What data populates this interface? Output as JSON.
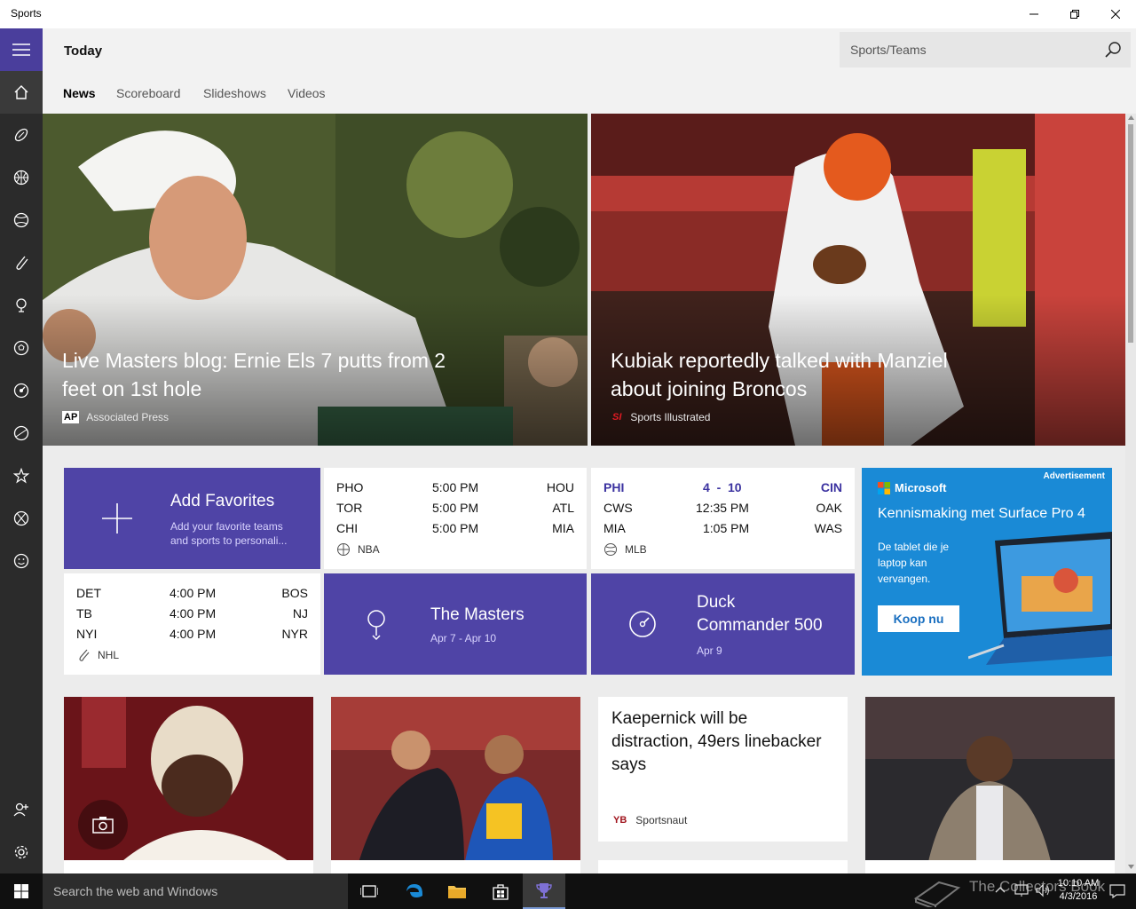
{
  "window": {
    "title": "Sports"
  },
  "header": {
    "title": "Today",
    "tabs": [
      {
        "label": "News",
        "active": true
      },
      {
        "label": "Scoreboard",
        "active": false
      },
      {
        "label": "Slideshows",
        "active": false
      },
      {
        "label": "Videos",
        "active": false
      }
    ],
    "search": {
      "placeholder": "Sports/Teams"
    }
  },
  "rail": {
    "items": [
      "menu-icon",
      "home-icon",
      "football-icon",
      "basketball-icon",
      "baseball-icon",
      "hockey-icon",
      "golf-icon",
      "soccer-icon",
      "nascar-icon",
      "tennis-icon",
      "star-icon",
      "sports-ball-icon",
      "smiley-icon",
      "add-user-icon",
      "gear-icon"
    ],
    "accent": "#4a3e9c"
  },
  "heroes": [
    {
      "headline": "Live Masters blog: Ernie Els 7 putts from 2 feet on 1st hole",
      "logo": "AP",
      "source": "Associated Press"
    },
    {
      "headline": "Kubiak reportedly talked with Manziel about joining Broncos",
      "logo": "SI",
      "source": "Sports Illustrated"
    }
  ],
  "favorites": {
    "title": "Add Favorites",
    "subtitle": "Add your favorite teams and sports to personali..."
  },
  "nba": {
    "league": "NBA",
    "games": [
      {
        "home": "PHO",
        "time": "5:00 PM",
        "away": "HOU"
      },
      {
        "home": "TOR",
        "time": "5:00 PM",
        "away": "ATL"
      },
      {
        "home": "CHI",
        "time": "5:00 PM",
        "away": "MIA"
      }
    ]
  },
  "mlb": {
    "league": "MLB",
    "games": [
      {
        "home": "PHI",
        "time": "4  -  10",
        "away": "CIN",
        "highlight": true
      },
      {
        "home": "CWS",
        "time": "12:35 PM",
        "away": "OAK"
      },
      {
        "home": "MIA",
        "time": "1:05 PM",
        "away": "WAS"
      }
    ]
  },
  "nhl": {
    "league": "NHL",
    "games": [
      {
        "home": "DET",
        "time": "4:00 PM",
        "away": "BOS"
      },
      {
        "home": "TB",
        "time": "4:00 PM",
        "away": "NJ"
      },
      {
        "home": "NYI",
        "time": "4:00 PM",
        "away": "NYR"
      }
    ]
  },
  "masters": {
    "title": "The Masters",
    "dates": "Apr 7 - Apr 10"
  },
  "duck": {
    "title_line1": "Duck",
    "title_line2": "Commander 500",
    "date": "Apr 9"
  },
  "ad": {
    "label": "Advertisement",
    "brand": "Microsoft",
    "headline": "Kennismaking met Surface Pro 4",
    "body_lines": [
      "De tablet die je",
      "laptop kan",
      "vervangen."
    ],
    "cta": "Koop nu"
  },
  "stories": [
    {
      "headline_lines": [
        "Kaepernick will be",
        "distraction, 49ers linebacker",
        "says"
      ],
      "logo": "YB",
      "source": "Sportsnaut"
    }
  ],
  "taskbar": {
    "search_placeholder": "Search the web and Windows",
    "time": "10:10 AM",
    "date": "4/3/2016",
    "watermark": "The Collectors Book"
  },
  "colors": {
    "purple": "#4f44a6",
    "ad_blue": "#1a8ad6",
    "mlb_score_blue": "#3b32a0"
  }
}
